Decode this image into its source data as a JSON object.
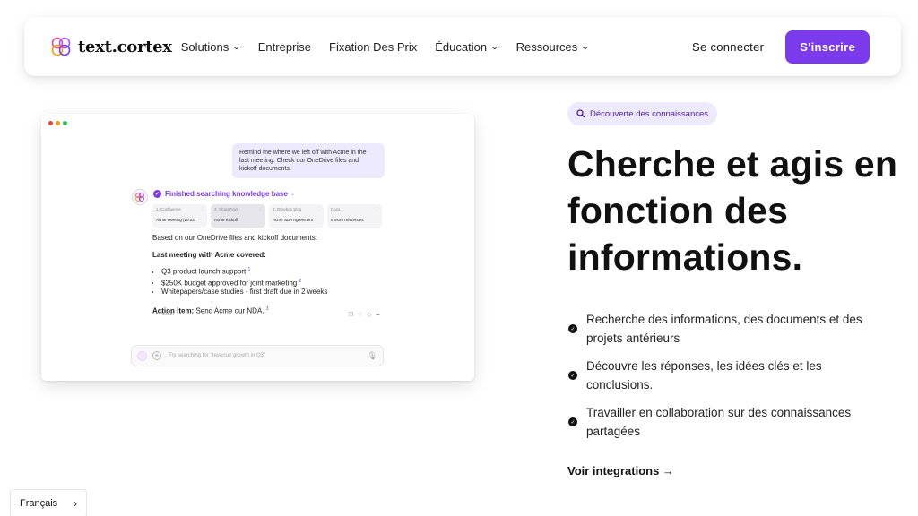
{
  "nav": {
    "brand": "text.cortex",
    "items": [
      {
        "label": "Solutions",
        "has_dropdown": true
      },
      {
        "label": "Entreprise",
        "has_dropdown": false
      },
      {
        "label": "Fixation Des Prix",
        "has_dropdown": false
      },
      {
        "label": "Éducation",
        "has_dropdown": true
      },
      {
        "label": "Ressources",
        "has_dropdown": true
      }
    ],
    "login": "Se connecter",
    "signup": "S'inscrire"
  },
  "mock": {
    "user_message": "Remind me where we left off with Acme in the last meeting. Check our OneDrive files and kickoff documents.",
    "status": "Finished searching knowledge base",
    "sources": [
      {
        "index": "1.",
        "source": "Confluence",
        "title": "Acme Meeting (10.03)"
      },
      {
        "index": "2.",
        "source": "SharePoint",
        "title": "Acme Kickoff"
      },
      {
        "index": "3.",
        "source": "Dropbox Sign",
        "title": "Acme NDA Agreement"
      },
      {
        "index": "",
        "source": "Docs",
        "title": "5 more references"
      }
    ],
    "answer_intro": "Based on our OneDrive files and kickoff documents:",
    "answer_heading": "Last meeting with Acme covered:",
    "answer_items": [
      {
        "text": "Q3 product launch support",
        "ref": "1"
      },
      {
        "text": "$250K budget approved for joint marketing",
        "ref": "2"
      },
      {
        "text": "Whitepapers/case studies - first draft due in 2 weeks",
        "ref": ""
      }
    ],
    "action_label": "Action item:",
    "action_text": "Send Acme our NDA.",
    "action_ref": "3",
    "add_action": "+ Action",
    "input_placeholder": "Try searching for \"revenue growth in Q3\""
  },
  "hero": {
    "badge": "Découverte des connaissances",
    "title": "Cherche et agis en fonction des informations.",
    "bullets": [
      "Recherche des informations, des documents et des projets antérieurs",
      "Découvre les réponses, les idées clés et les conclusions.",
      "Travailler en collaboration sur des connaissances partagées"
    ],
    "link": "Voir integrations →"
  },
  "language": {
    "label": "Français"
  },
  "colors": {
    "accent": "#7c3aed",
    "badge_bg": "#ede9fe",
    "bubble_bg": "#ede9fe"
  }
}
